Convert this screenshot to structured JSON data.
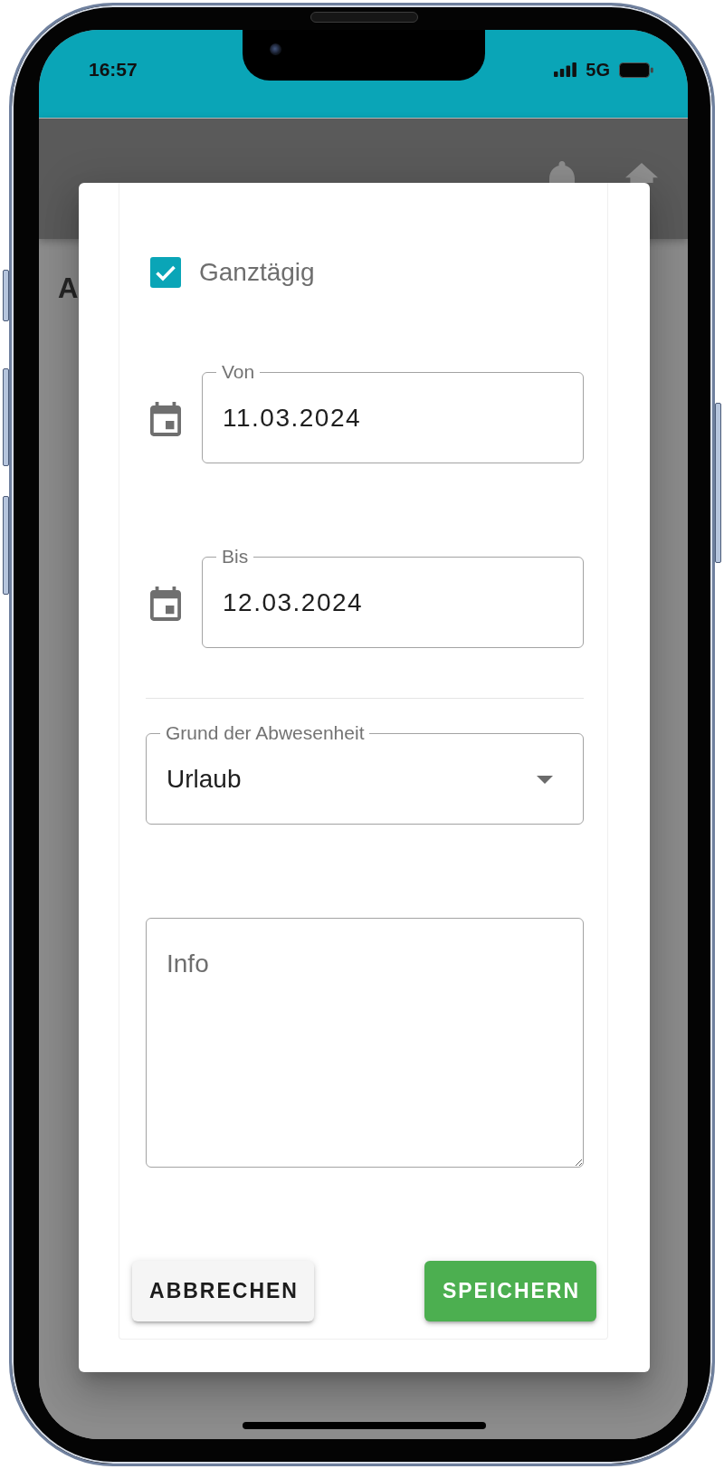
{
  "status_bar": {
    "time": "16:57",
    "network": "5G"
  },
  "page": {
    "title": "A"
  },
  "dialog": {
    "all_day": {
      "label": "Ganztägig",
      "checked": true
    },
    "date_fields": [
      {
        "label": "Von",
        "value": "11.03.2024"
      },
      {
        "label": "Bis",
        "value": "12.03.2024"
      }
    ],
    "reason": {
      "label": "Grund der Abwesenheit",
      "value": "Urlaub"
    },
    "info": {
      "placeholder": "Info"
    },
    "buttons": [
      {
        "label": "ABBRECHEN",
        "kind": "secondary"
      },
      {
        "label": "SPEICHERN",
        "kind": "primary"
      }
    ]
  }
}
